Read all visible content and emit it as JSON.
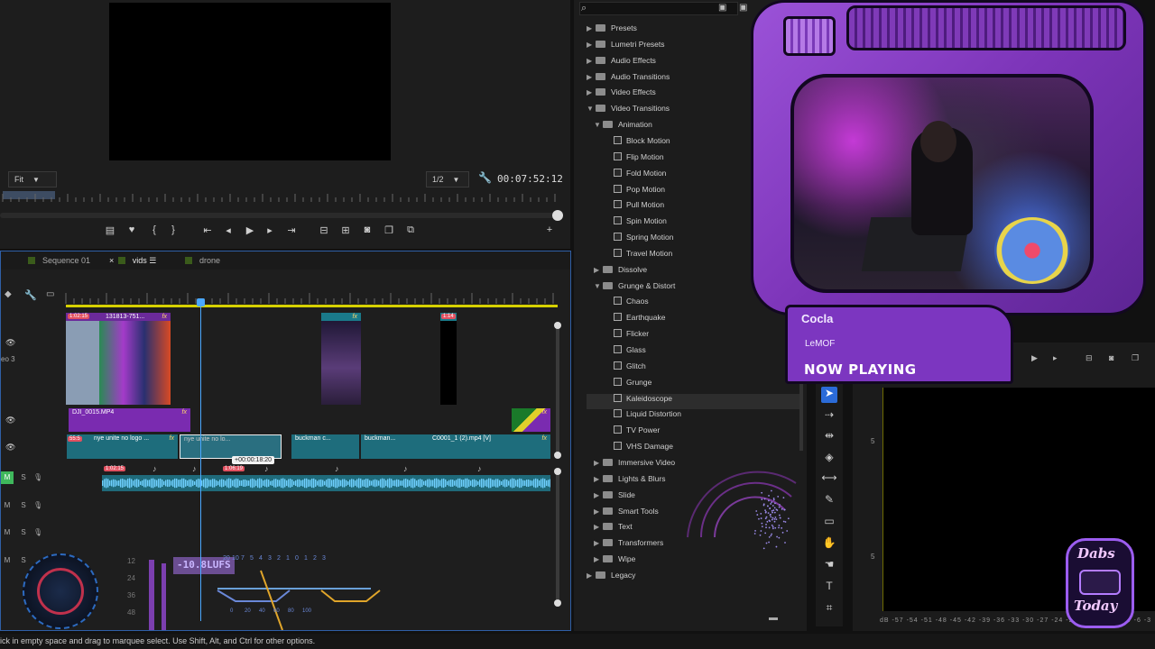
{
  "monitor": {
    "fit_value": "Fit",
    "quality_value": "1/2",
    "timecode": "00:07:52:12"
  },
  "timeline": {
    "tabs": [
      {
        "label": "Sequence 01",
        "color": "#3a5b1b"
      },
      {
        "label": "vids",
        "color": "#3a5b1b",
        "active": true
      },
      {
        "label": "drone",
        "color": "#3a5b1b"
      }
    ],
    "track_label_v3": "eo 3",
    "clips_v3": [
      {
        "name": "131813-751...",
        "badge": "1:02:15"
      },
      {
        "name": ""
      },
      {
        "name": "",
        "badge": "1:14"
      }
    ],
    "clip_v2": {
      "name": "DJI_0015.MP4"
    },
    "clips_v1": [
      {
        "name": "nye unite no logo ...",
        "badge": "55:5"
      },
      {
        "name": "nye unite no lo..."
      },
      {
        "name": "buckman c..."
      },
      {
        "name": "buckman..."
      },
      {
        "name": "C0001_1 (2).mp4 [V]"
      }
    ],
    "drag_tooltip": "+00:00:18:20",
    "audio_badges": [
      "1:02:15",
      "1:06:19"
    ],
    "audio_row_label": "M",
    "lufs": "-10.8LUFS",
    "meter_scale": [
      "20",
      "10",
      "7",
      "5",
      "4",
      "3",
      "2",
      "1",
      "0",
      "1",
      "2",
      "3"
    ],
    "meter_left": [
      "12",
      "24",
      "36",
      "48"
    ],
    "meter_bottom": [
      "0",
      "20",
      "40",
      "60",
      "80",
      "100"
    ],
    "fx_label": "fx"
  },
  "effects": {
    "search_placeholder": "",
    "items": [
      {
        "label": "Presets",
        "level": 0,
        "type": "folder",
        "expanded": false
      },
      {
        "label": "Lumetri Presets",
        "level": 0,
        "type": "folder",
        "expanded": false
      },
      {
        "label": "Audio Effects",
        "level": 0,
        "type": "folder",
        "expanded": false
      },
      {
        "label": "Audio Transitions",
        "level": 0,
        "type": "folder",
        "expanded": false
      },
      {
        "label": "Video Effects",
        "level": 0,
        "type": "folder",
        "expanded": false
      },
      {
        "label": "Video Transitions",
        "level": 0,
        "type": "folder",
        "expanded": true
      },
      {
        "label": "Animation",
        "level": 1,
        "type": "folder",
        "expanded": true
      },
      {
        "label": "Block Motion",
        "level": 2,
        "type": "fx"
      },
      {
        "label": "Flip Motion",
        "level": 2,
        "type": "fx"
      },
      {
        "label": "Fold Motion",
        "level": 2,
        "type": "fx"
      },
      {
        "label": "Pop Motion",
        "level": 2,
        "type": "fx"
      },
      {
        "label": "Pull Motion",
        "level": 2,
        "type": "fx"
      },
      {
        "label": "Spin Motion",
        "level": 2,
        "type": "fx"
      },
      {
        "label": "Spring Motion",
        "level": 2,
        "type": "fx"
      },
      {
        "label": "Travel Motion",
        "level": 2,
        "type": "fx"
      },
      {
        "label": "Dissolve",
        "level": 1,
        "type": "folder",
        "expanded": false
      },
      {
        "label": "Grunge & Distort",
        "level": 1,
        "type": "folder",
        "expanded": true
      },
      {
        "label": "Chaos",
        "level": 2,
        "type": "fx"
      },
      {
        "label": "Earthquake",
        "level": 2,
        "type": "fx"
      },
      {
        "label": "Flicker",
        "level": 2,
        "type": "fx"
      },
      {
        "label": "Glass",
        "level": 2,
        "type": "fx"
      },
      {
        "label": "Glitch",
        "level": 2,
        "type": "fx"
      },
      {
        "label": "Grunge",
        "level": 2,
        "type": "fx"
      },
      {
        "label": "Kaleidoscope",
        "level": 2,
        "type": "fx",
        "selected": true
      },
      {
        "label": "Liquid Distortion",
        "level": 2,
        "type": "fx"
      },
      {
        "label": "TV Power",
        "level": 2,
        "type": "fx"
      },
      {
        "label": "VHS Damage",
        "level": 2,
        "type": "fx"
      },
      {
        "label": "Immersive Video",
        "level": 1,
        "type": "folder",
        "expanded": false
      },
      {
        "label": "Lights & Blurs",
        "level": 1,
        "type": "folder",
        "expanded": false
      },
      {
        "label": "Slide",
        "level": 1,
        "type": "folder",
        "expanded": false
      },
      {
        "label": "Smart Tools",
        "level": 1,
        "type": "folder",
        "expanded": false
      },
      {
        "label": "Text",
        "level": 1,
        "type": "folder",
        "expanded": false
      },
      {
        "label": "Transformers",
        "level": 1,
        "type": "folder",
        "expanded": false
      },
      {
        "label": "Wipe",
        "level": 1,
        "type": "folder",
        "expanded": false
      },
      {
        "label": "Legacy",
        "level": 0,
        "type": "folder",
        "expanded": false
      }
    ]
  },
  "now_playing": {
    "track": "Cocla",
    "artist": "LeMOF",
    "label": "NOW PLAYING"
  },
  "right_panel": {
    "ticks": [
      "5",
      "5"
    ],
    "scale": "dB -57 -54 -51 -48 -45 -42 -39 -36 -33 -30 -27 -24 -21 -18 -15 -12 -9 -6 -3"
  },
  "logo": {
    "line1": "Dabs",
    "line2": "Today"
  },
  "status_bar": {
    "text": "ick in empty space and drag to marquee select. Use Shift, Alt, and Ctrl for other options."
  },
  "colors": {
    "clip_purple": "#7a2bb0",
    "clip_teal": "#1e6d7c",
    "accent_blue": "#2b6bd8",
    "work_area": "#d6d000"
  }
}
